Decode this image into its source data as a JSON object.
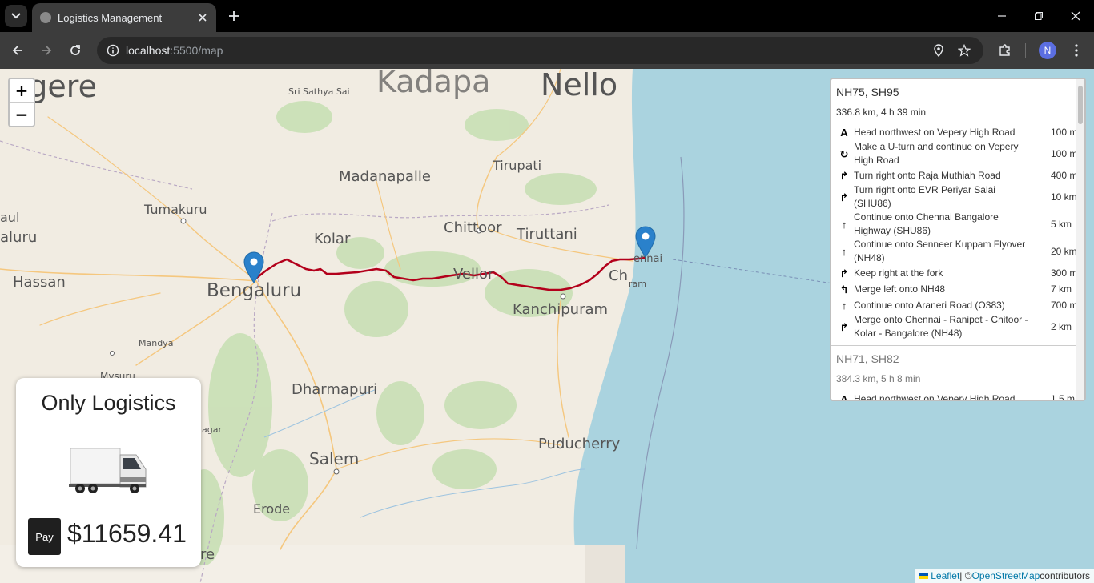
{
  "browser": {
    "tab_title": "Logistics Management",
    "url_host": "localhost",
    "url_rest": ":5500/map",
    "profile_initial": "N"
  },
  "map": {
    "zoom_in": "+",
    "zoom_out": "−",
    "places": {
      "kadapa": "Kadapa",
      "nellore": "Nello",
      "davangere": "agere",
      "madanapalle": "Madanapalle",
      "tirupati": "Tirupati",
      "tumakuru": "Tumakuru",
      "kolar": "Kolar",
      "chittoor": "Chittoor",
      "tiruttani": "Tiruttani",
      "bengaluru": "Bengaluru",
      "hassan": "Hassan",
      "aluru": "aluru",
      "vellore": "Vellor",
      "chennai": "ennai",
      "kanchipuram": "Kanchipuram",
      "mandya": "Mandya",
      "mysuru": "Mysuru",
      "dharmapuri": "Dharmapuri",
      "puducherry": "Puducherry",
      "salem": "Salem",
      "erode": "Erode",
      "sri_sathya": "Sri Sathya Sai",
      "ram": "ram",
      "ch": "Ch",
      "re": "re",
      "agar": "agar",
      "aul": "aul"
    },
    "attribution": {
      "leaflet": "Leaflet",
      "sep": " | © ",
      "osm": "OpenStreetMap",
      "contrib": " contributors"
    }
  },
  "routes": [
    {
      "name": "NH75, SH95",
      "summary": "336.8 km, 4 h 39 min",
      "instructions": [
        {
          "icon": "depart-icon",
          "glyph": "A",
          "text": "Head northwest on Vepery High Road",
          "distance": "100 m"
        },
        {
          "icon": "u-turn-icon",
          "glyph": "↻",
          "text": "Make a U-turn and continue on Vepery High Road",
          "distance": "100 m"
        },
        {
          "icon": "turn-right-icon",
          "glyph": "↱",
          "text": "Turn right onto Raja Muthiah Road",
          "distance": "400 m"
        },
        {
          "icon": "turn-right-icon",
          "glyph": "↱",
          "text": "Turn right onto EVR Periyar Salai (SHU86)",
          "distance": "10 km"
        },
        {
          "icon": "continue-icon",
          "glyph": "↑",
          "text": "Continue onto Chennai Bangalore Highway (SHU86)",
          "distance": "5 km"
        },
        {
          "icon": "continue-icon",
          "glyph": "↑",
          "text": "Continue onto Senneer Kuppam Flyover (NH48)",
          "distance": "20 km"
        },
        {
          "icon": "keep-right-icon",
          "glyph": "↱",
          "text": "Keep right at the fork",
          "distance": "300 m"
        },
        {
          "icon": "merge-left-icon",
          "glyph": "↰",
          "text": "Merge left onto NH48",
          "distance": "7 km"
        },
        {
          "icon": "continue-icon",
          "glyph": "↑",
          "text": "Continue onto Araneri Road (O383)",
          "distance": "700 m"
        },
        {
          "icon": "merge-right-icon",
          "glyph": "↱",
          "text": "Merge onto Chennai - Ranipet - Chitoor - Kolar - Bangalore (NH48)",
          "distance": "2 km"
        }
      ]
    },
    {
      "name": "NH71, SH82",
      "summary": "384.3 km, 5 h 8 min",
      "instructions": [
        {
          "icon": "depart-icon",
          "glyph": "A",
          "text": "Head northwest on Vepery High Road",
          "distance": "1.5 m"
        }
      ]
    }
  ],
  "card": {
    "title": "Only Logistics",
    "pay_label": "Pay",
    "price": "$11659.41"
  }
}
